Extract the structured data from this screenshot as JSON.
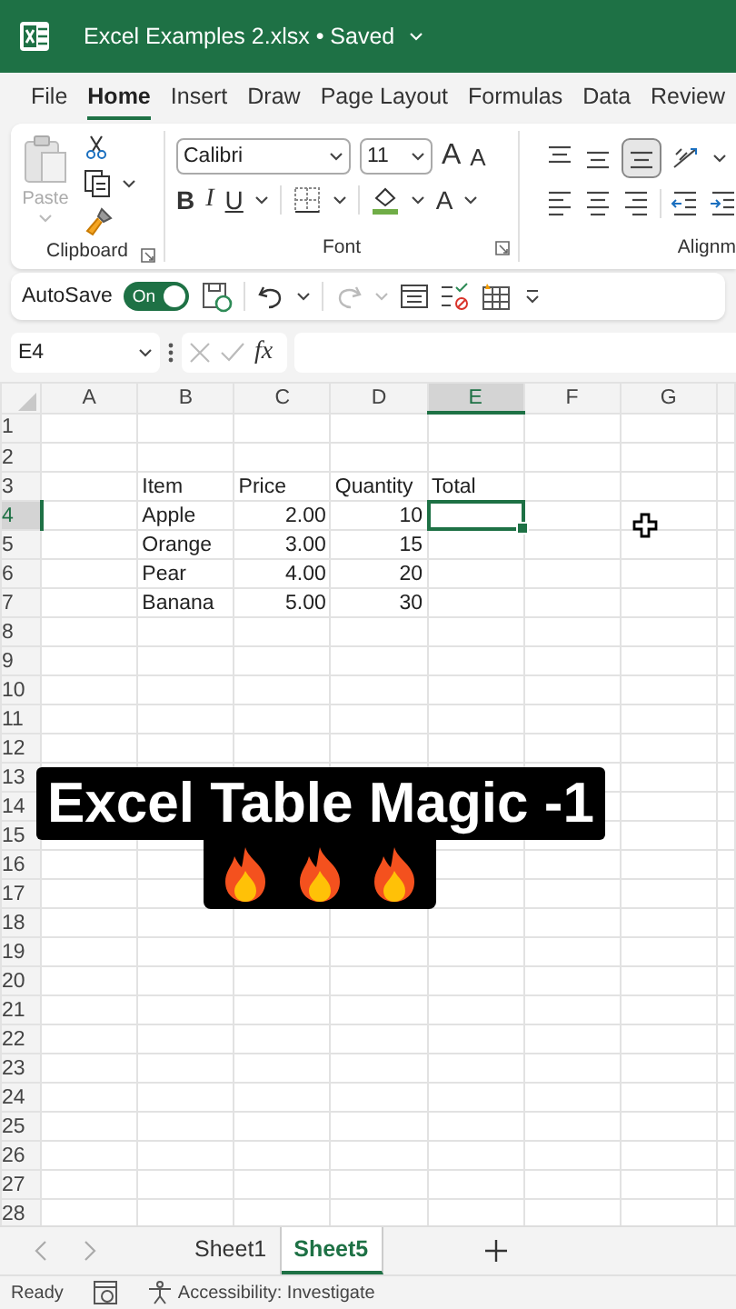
{
  "title_bar": {
    "file_name": "Excel Examples 2.xlsx • Saved"
  },
  "menu_tabs": [
    {
      "label": "File",
      "selected": false
    },
    {
      "label": "Home",
      "selected": true
    },
    {
      "label": "Insert",
      "selected": false
    },
    {
      "label": "Draw",
      "selected": false
    },
    {
      "label": "Page Layout",
      "selected": false
    },
    {
      "label": "Formulas",
      "selected": false
    },
    {
      "label": "Data",
      "selected": false
    },
    {
      "label": "Review",
      "selected": false
    }
  ],
  "ribbon": {
    "paste_label": "Paste",
    "font_name": "Calibri",
    "font_size": "11",
    "grow_font": "A",
    "shrink_font": "A",
    "bold": "B",
    "italic": "I",
    "underline": "U",
    "font_color": "A",
    "groups": [
      {
        "label": "Clipboard"
      },
      {
        "label": "Font"
      },
      {
        "label": "Alignm"
      }
    ]
  },
  "quick_access": {
    "autosave_label": "AutoSave",
    "autosave": {
      "on": true,
      "text": "On"
    }
  },
  "formula_bar": {
    "name_box": "E4",
    "fx": "fx"
  },
  "sheet": {
    "columns": [
      {
        "label": "A",
        "selected": false
      },
      {
        "label": "B",
        "selected": false
      },
      {
        "label": "C",
        "selected": false
      },
      {
        "label": "D",
        "selected": false
      },
      {
        "label": "E",
        "selected": true
      },
      {
        "label": "F",
        "selected": false
      },
      {
        "label": "G",
        "selected": false
      }
    ],
    "rows": [
      {
        "label": "1",
        "selected": false
      },
      {
        "label": "2",
        "selected": false
      },
      {
        "label": "3",
        "selected": false,
        "cells": [
          {
            "text": "Item",
            "kind": "text"
          },
          {
            "text": "Price",
            "kind": "text"
          },
          {
            "text": "Quantity",
            "kind": "text"
          },
          {
            "text": "Total",
            "kind": "text"
          }
        ]
      },
      {
        "label": "4",
        "selected": true,
        "cells": [
          {
            "text": "Apple",
            "kind": "text"
          },
          {
            "text": "2.00",
            "kind": "number"
          },
          {
            "text": "10",
            "kind": "number"
          }
        ]
      },
      {
        "label": "5",
        "selected": false,
        "cells": [
          {
            "text": "Orange",
            "kind": "text"
          },
          {
            "text": "3.00",
            "kind": "number"
          },
          {
            "text": "15",
            "kind": "number"
          }
        ]
      },
      {
        "label": "6",
        "selected": false,
        "cells": [
          {
            "text": "Pear",
            "kind": "text"
          },
          {
            "text": "4.00",
            "kind": "number"
          },
          {
            "text": "20",
            "kind": "number"
          }
        ]
      },
      {
        "label": "7",
        "selected": false,
        "cells": [
          {
            "text": "Banana",
            "kind": "text"
          },
          {
            "text": "5.00",
            "kind": "number"
          },
          {
            "text": "30",
            "kind": "number"
          }
        ]
      },
      {
        "label": "8",
        "selected": false
      },
      {
        "label": "9",
        "selected": false
      },
      {
        "label": "10",
        "selected": false
      },
      {
        "label": "11",
        "selected": false
      },
      {
        "label": "12",
        "selected": false
      },
      {
        "label": "13",
        "selected": false
      },
      {
        "label": "14",
        "selected": false
      },
      {
        "label": "15",
        "selected": false
      },
      {
        "label": "16",
        "selected": false
      },
      {
        "label": "17",
        "selected": false
      },
      {
        "label": "18",
        "selected": false
      },
      {
        "label": "19",
        "selected": false
      },
      {
        "label": "20",
        "selected": false
      },
      {
        "label": "21",
        "selected": false
      },
      {
        "label": "22",
        "selected": false
      },
      {
        "label": "23",
        "selected": false
      },
      {
        "label": "24",
        "selected": false
      },
      {
        "label": "25",
        "selected": false
      },
      {
        "label": "26",
        "selected": false
      },
      {
        "label": "27",
        "selected": false
      },
      {
        "label": "28",
        "selected": false
      }
    ]
  },
  "sheet_tabs": [
    {
      "label": "Sheet1",
      "selected": false
    },
    {
      "label": "Sheet5",
      "selected": true
    }
  ],
  "status_bar": {
    "status": "Ready",
    "accessibility": "Accessibility: Investigate"
  },
  "caption": {
    "text": "Excel Table Magic -1"
  }
}
